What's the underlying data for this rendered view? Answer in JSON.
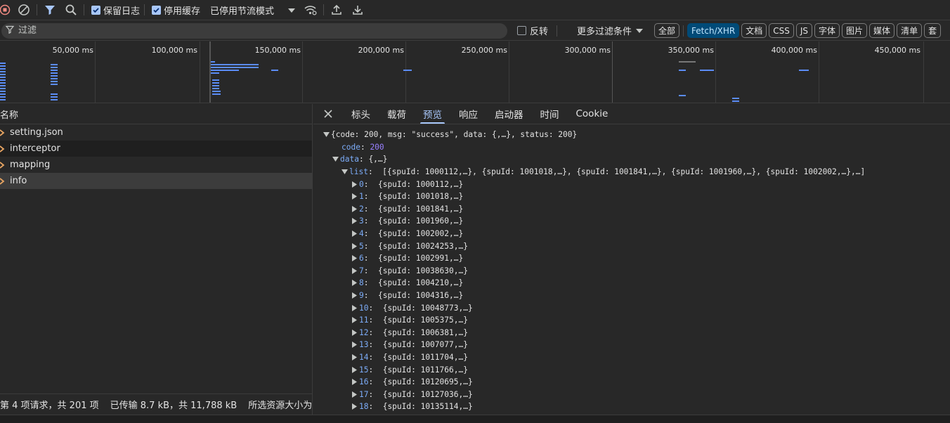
{
  "toolbar": {
    "record_icon": "stop-recording-icon",
    "clear_icon": "clear-icon",
    "filter_icon": "filter-icon",
    "search_icon": "search-icon",
    "preserve_log_label": "保留日志",
    "preserve_log_checked": true,
    "disable_cache_label": "停用缓存",
    "disable_cache_checked": true,
    "throttling_label": "已停用节流模式",
    "network_conditions_icon": "wifi-settings-icon",
    "import_icon": "upload-icon",
    "export_icon": "download-icon"
  },
  "filter": {
    "placeholder": "过滤",
    "invert_label": "反转",
    "more_filters_label": "更多过滤条件",
    "chips": [
      {
        "label": "全部",
        "active": false
      },
      {
        "label": "Fetch/XHR",
        "active": true
      },
      {
        "label": "文档",
        "active": false
      },
      {
        "label": "CSS",
        "active": false
      },
      {
        "label": "JS",
        "active": false
      },
      {
        "label": "字体",
        "active": false
      },
      {
        "label": "图片",
        "active": false
      },
      {
        "label": "媒体",
        "active": false
      },
      {
        "label": "清单",
        "active": false
      },
      {
        "label": "套",
        "active": false
      }
    ]
  },
  "overview": {
    "tick_labels": [
      "50,000 ms",
      "100,000 ms",
      "150,000 ms",
      "200,000 ms",
      "250,000 ms",
      "300,000 ms",
      "350,000 ms",
      "400,000 ms",
      "450,000 ms"
    ],
    "bar_color": "#5b8cf5"
  },
  "request_list": {
    "header": "名称",
    "rows": [
      {
        "name": "setting.json",
        "selected": false
      },
      {
        "name": "interceptor",
        "selected": false
      },
      {
        "name": "mapping",
        "selected": false
      },
      {
        "name": "info",
        "selected": true
      }
    ]
  },
  "status_bar": {
    "requests": "第 4 项请求，共 201 项",
    "transferred": "已传输 8.7 kB，共 11,788 kB",
    "resources": "所选资源大小为"
  },
  "detail": {
    "close_icon": "close-icon",
    "tabs": [
      {
        "label": "标头",
        "active": false
      },
      {
        "label": "载荷",
        "active": false
      },
      {
        "label": "预览",
        "active": true
      },
      {
        "label": "响应",
        "active": false
      },
      {
        "label": "启动器",
        "active": false
      },
      {
        "label": "时间",
        "active": false
      },
      {
        "label": "Cookie",
        "active": false
      }
    ]
  },
  "preview": {
    "root_summary": "{code: 200, msg: \"success\", data: {,…}, status: 200}",
    "code_key": "code",
    "code_value": "200",
    "data_key": "data",
    "data_summary": "{,…}",
    "list_key": "list",
    "list_summary": "[{spuId: 1000112,…}, {spuId: 1001018,…}, {spuId: 1001841,…}, {spuId: 1001960,…}, {spuId: 1002002,…},…]",
    "items": [
      {
        "index": "0",
        "summary": "{spuId: 1000112,…}"
      },
      {
        "index": "1",
        "summary": "{spuId: 1001018,…}"
      },
      {
        "index": "2",
        "summary": "{spuId: 1001841,…}"
      },
      {
        "index": "3",
        "summary": "{spuId: 1001960,…}"
      },
      {
        "index": "4",
        "summary": "{spuId: 1002002,…}"
      },
      {
        "index": "5",
        "summary": "{spuId: 10024253,…}"
      },
      {
        "index": "6",
        "summary": "{spuId: 1002991,…}"
      },
      {
        "index": "7",
        "summary": "{spuId: 10038630,…}"
      },
      {
        "index": "8",
        "summary": "{spuId: 1004210,…}"
      },
      {
        "index": "9",
        "summary": "{spuId: 1004316,…}"
      },
      {
        "index": "10",
        "summary": "{spuId: 10048773,…}"
      },
      {
        "index": "11",
        "summary": "{spuId: 1005375,…}"
      },
      {
        "index": "12",
        "summary": "{spuId: 1006381,…}"
      },
      {
        "index": "13",
        "summary": "{spuId: 1007077,…}"
      },
      {
        "index": "14",
        "summary": "{spuId: 1011704,…}"
      },
      {
        "index": "15",
        "summary": "{spuId: 1011766,…}"
      },
      {
        "index": "16",
        "summary": "{spuId: 10120695,…}"
      },
      {
        "index": "17",
        "summary": "{spuId: 10127036,…}"
      },
      {
        "index": "18",
        "summary": "{spuId: 10135114,…}"
      }
    ]
  },
  "colors": {
    "background": "#282828",
    "accent": "#a8c7fa",
    "key_blue": "#7cacf8",
    "number_purple": "#9980ff",
    "record_red": "#f28b82"
  }
}
